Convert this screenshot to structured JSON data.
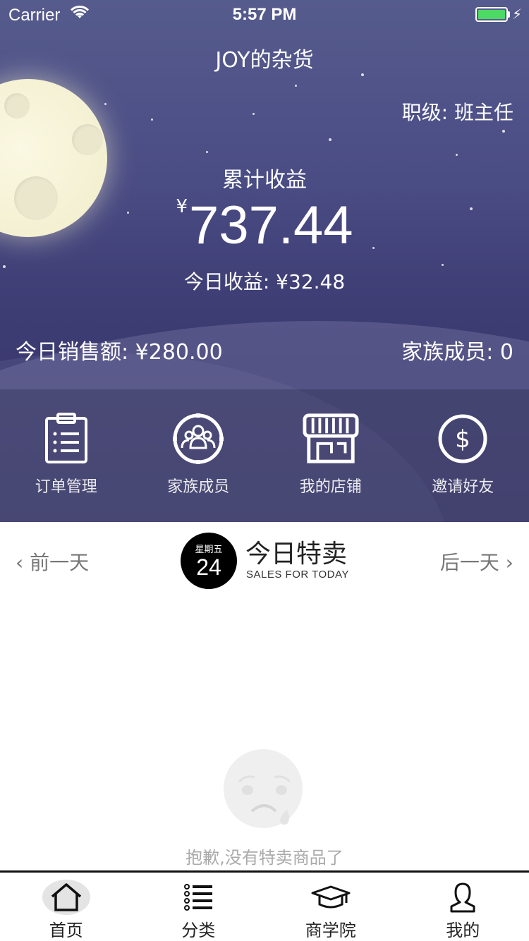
{
  "status_bar": {
    "carrier": "Carrier",
    "time": "5:57 PM"
  },
  "header": {
    "shop_name": "JOY的杂货",
    "rank": "职级: 班主任",
    "total_label": "累计收益",
    "currency": "¥",
    "total_amount": "737.44",
    "today_earn": "今日收益: ¥32.48",
    "today_sales": "今日销售额: ¥280.00",
    "family_members": "家族成员: 0"
  },
  "actions": [
    {
      "label": "订单管理",
      "icon": "clipboard-icon"
    },
    {
      "label": "家族成员",
      "icon": "family-group-icon"
    },
    {
      "label": "我的店铺",
      "icon": "store-icon"
    },
    {
      "label": "邀请好友",
      "icon": "dollar-circle-icon"
    }
  ],
  "special": {
    "prev": "前一天",
    "next": "后一天",
    "weekday": "星期五",
    "day": "24",
    "title": "今日特卖",
    "subtitle": "SALES FOR TODAY",
    "empty_text": "抱歉,没有特卖商品了"
  },
  "tabs": [
    {
      "label": "首页",
      "icon": "home-icon",
      "active": true
    },
    {
      "label": "分类",
      "icon": "list-icon",
      "active": false
    },
    {
      "label": "商学院",
      "icon": "graduation-cap-icon",
      "active": false
    },
    {
      "label": "我的",
      "icon": "person-icon",
      "active": false
    }
  ],
  "colors": {
    "battery": "#4cd964",
    "hero_top": "#565b8d",
    "hero_bottom": "#36346a"
  }
}
